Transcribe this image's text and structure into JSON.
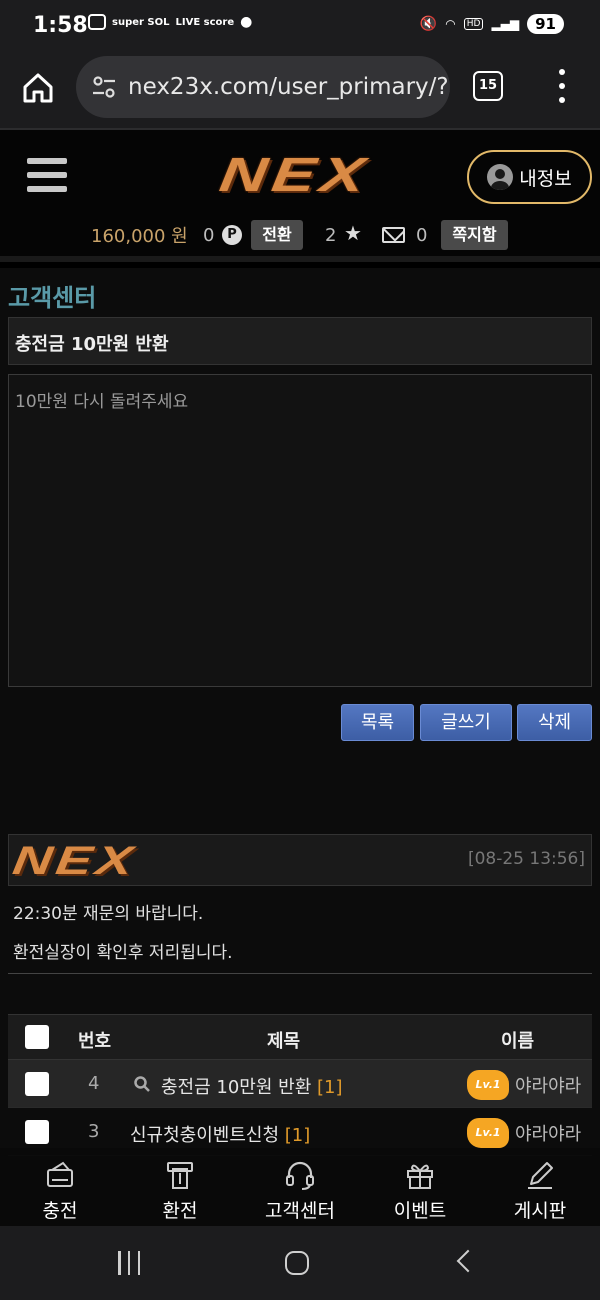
{
  "status_bar": {
    "time": "1:58",
    "app_icons": [
      "super SOL",
      "LIVE score"
    ],
    "battery": "91"
  },
  "browser": {
    "url": "nex23x.com/user_primary/?s",
    "tab_count": "15"
  },
  "header": {
    "logo": "NEX",
    "my_info_label": "내정보",
    "money": "160,000 원",
    "points": "0",
    "point_badge": "P",
    "convert_button": "전환",
    "stars": "2",
    "messages": "0",
    "inbox_button": "쪽지함"
  },
  "post": {
    "section_title": "고객센터",
    "subject": "충전금 10만원 반환",
    "body": "10만원 다시 돌려주세요",
    "buttons": {
      "list": "목록",
      "write": "글쓰기",
      "delete": "삭제"
    }
  },
  "reply": {
    "logo": "NEX",
    "date": "[08-25 13:56]",
    "lines": [
      "22:30분 재문의 바랍니다.",
      "환전실장이 확인후 저리됩니다."
    ]
  },
  "table": {
    "headers": {
      "number": "번호",
      "title": "제목",
      "name": "이름"
    },
    "rows": [
      {
        "number": "4",
        "title": "충전금 10만원 반환",
        "comments": "[1]",
        "level": "Lv.1",
        "name": "야라야라"
      },
      {
        "number": "3",
        "title": "신규첫충이벤트신청",
        "comments": "[1]",
        "level": "Lv.1",
        "name": "야라야라"
      }
    ]
  },
  "bottom_nav": {
    "items": [
      "충전",
      "환전",
      "고객센터",
      "이벤트",
      "게시판"
    ]
  },
  "colors": {
    "accent_gold": "#e2b969",
    "section_teal": "#5a9aa8",
    "button_blue": "#4a6bb5",
    "comment_orange": "#e09a2a"
  }
}
